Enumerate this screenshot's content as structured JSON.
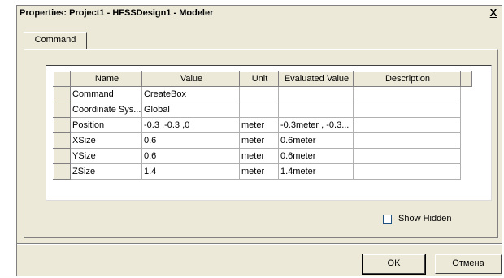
{
  "window": {
    "title": "Properties: Project1 - HFSSDesign1 - Modeler",
    "close_glyph": "X"
  },
  "tabs": [
    {
      "label": "Command",
      "active": true
    }
  ],
  "grid": {
    "columns": [
      "Name",
      "Value",
      "Unit",
      "Evaluated Value",
      "Description"
    ],
    "rows": [
      {
        "name": "Command",
        "value": "CreateBox",
        "unit": "",
        "evaluated": "",
        "description": ""
      },
      {
        "name": "Coordinate Sys...",
        "value": "Global",
        "unit": "",
        "evaluated": "",
        "description": ""
      },
      {
        "name": "Position",
        "value": "-0.3 ,-0.3 ,0",
        "unit": "meter",
        "evaluated": "-0.3meter , -0.3...",
        "description": ""
      },
      {
        "name": "XSize",
        "value": "0.6",
        "unit": "meter",
        "evaluated": "0.6meter",
        "description": ""
      },
      {
        "name": "YSize",
        "value": "0.6",
        "unit": "meter",
        "evaluated": "0.6meter",
        "description": ""
      },
      {
        "name": "ZSize",
        "value": "1.4",
        "unit": "meter",
        "evaluated": "1.4meter",
        "description": ""
      }
    ]
  },
  "show_hidden": {
    "label": "Show Hidden",
    "checked": false
  },
  "buttons": {
    "ok": "OK",
    "cancel": "Отмена"
  },
  "colors": {
    "dialog_bg": "#ece9d8",
    "grid_bg": "#ffffff"
  }
}
